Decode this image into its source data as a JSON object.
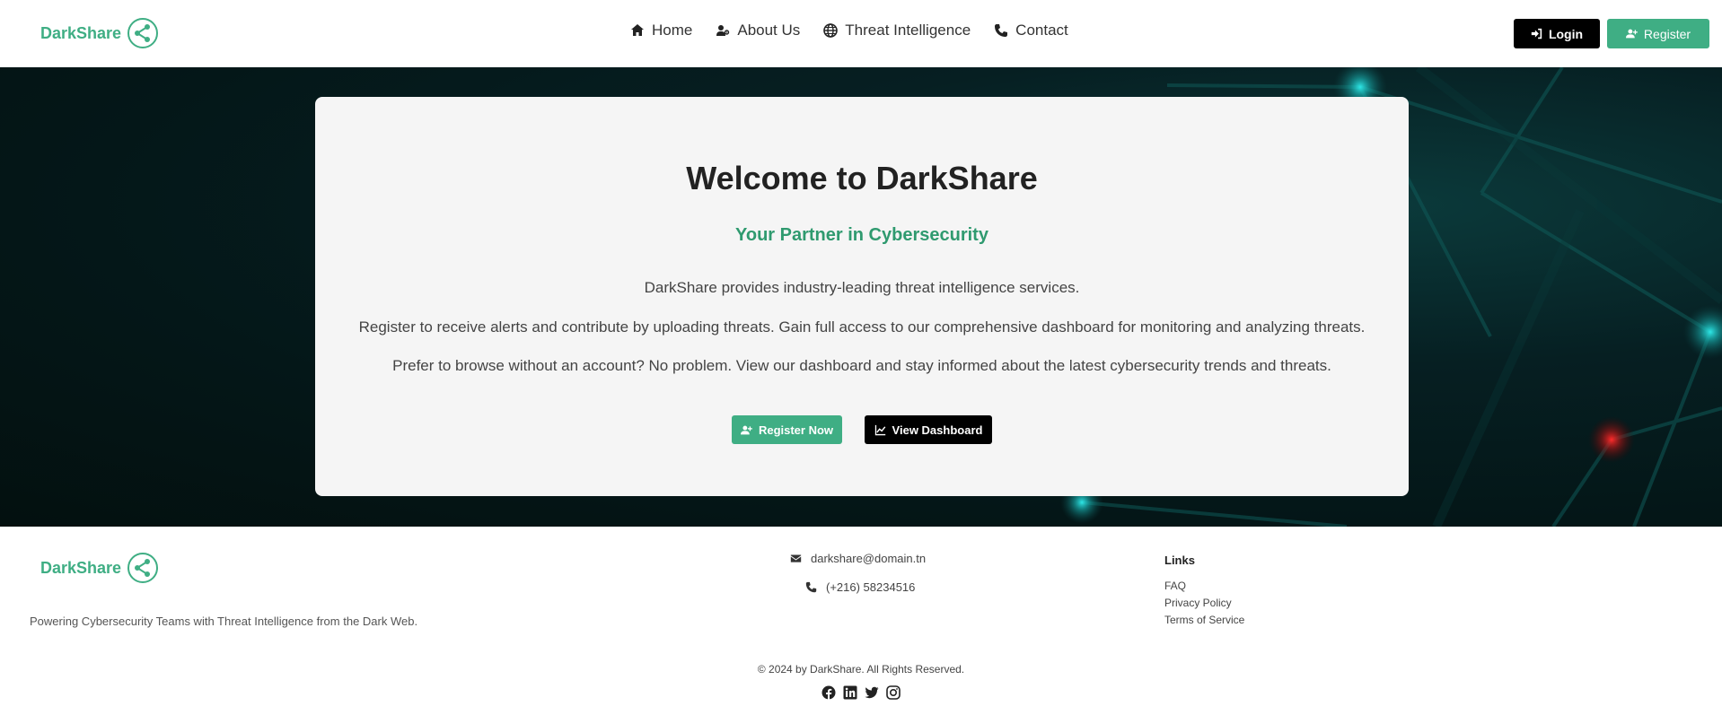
{
  "brand": {
    "name": "DarkShare",
    "color": "#3fae84"
  },
  "nav": {
    "items": [
      {
        "label": "Home",
        "icon": "home-icon"
      },
      {
        "label": "About Us",
        "icon": "user-secret-icon"
      },
      {
        "label": "Threat Intelligence",
        "icon": "globe-icon"
      },
      {
        "label": "Contact",
        "icon": "phone-icon"
      }
    ],
    "login_label": "Login",
    "register_label": "Register"
  },
  "hero": {
    "title": "Welcome to DarkShare",
    "subtitle": "Your Partner in Cybersecurity",
    "paragraphs": [
      "DarkShare provides industry-leading threat intelligence services.",
      "Register to receive alerts and contribute by uploading threats. Gain full access to our comprehensive dashboard for monitoring and analyzing threats.",
      "Prefer to browse without an account? No problem. View our dashboard and stay informed about the latest cybersecurity trends and threats."
    ],
    "register_now_label": "Register Now",
    "view_dashboard_label": "View Dashboard"
  },
  "footer": {
    "tagline": "Powering Cybersecurity Teams with Threat Intelligence from the Dark Web.",
    "email": "darkshare@domain.tn",
    "phone": "(+216) 58234516",
    "links_title": "Links",
    "links": [
      "FAQ",
      "Privacy Policy",
      "Terms of Service"
    ],
    "copyright": "© 2024 by DarkShare. All Rights Reserved.",
    "social": [
      "facebook-icon",
      "linkedin-icon",
      "twitter-icon",
      "instagram-icon"
    ]
  },
  "colors": {
    "accent": "#3fae84",
    "accent_dark": "#2f9a6f",
    "hero_bg": "#041617",
    "card_bg": "#f5f5f5"
  }
}
